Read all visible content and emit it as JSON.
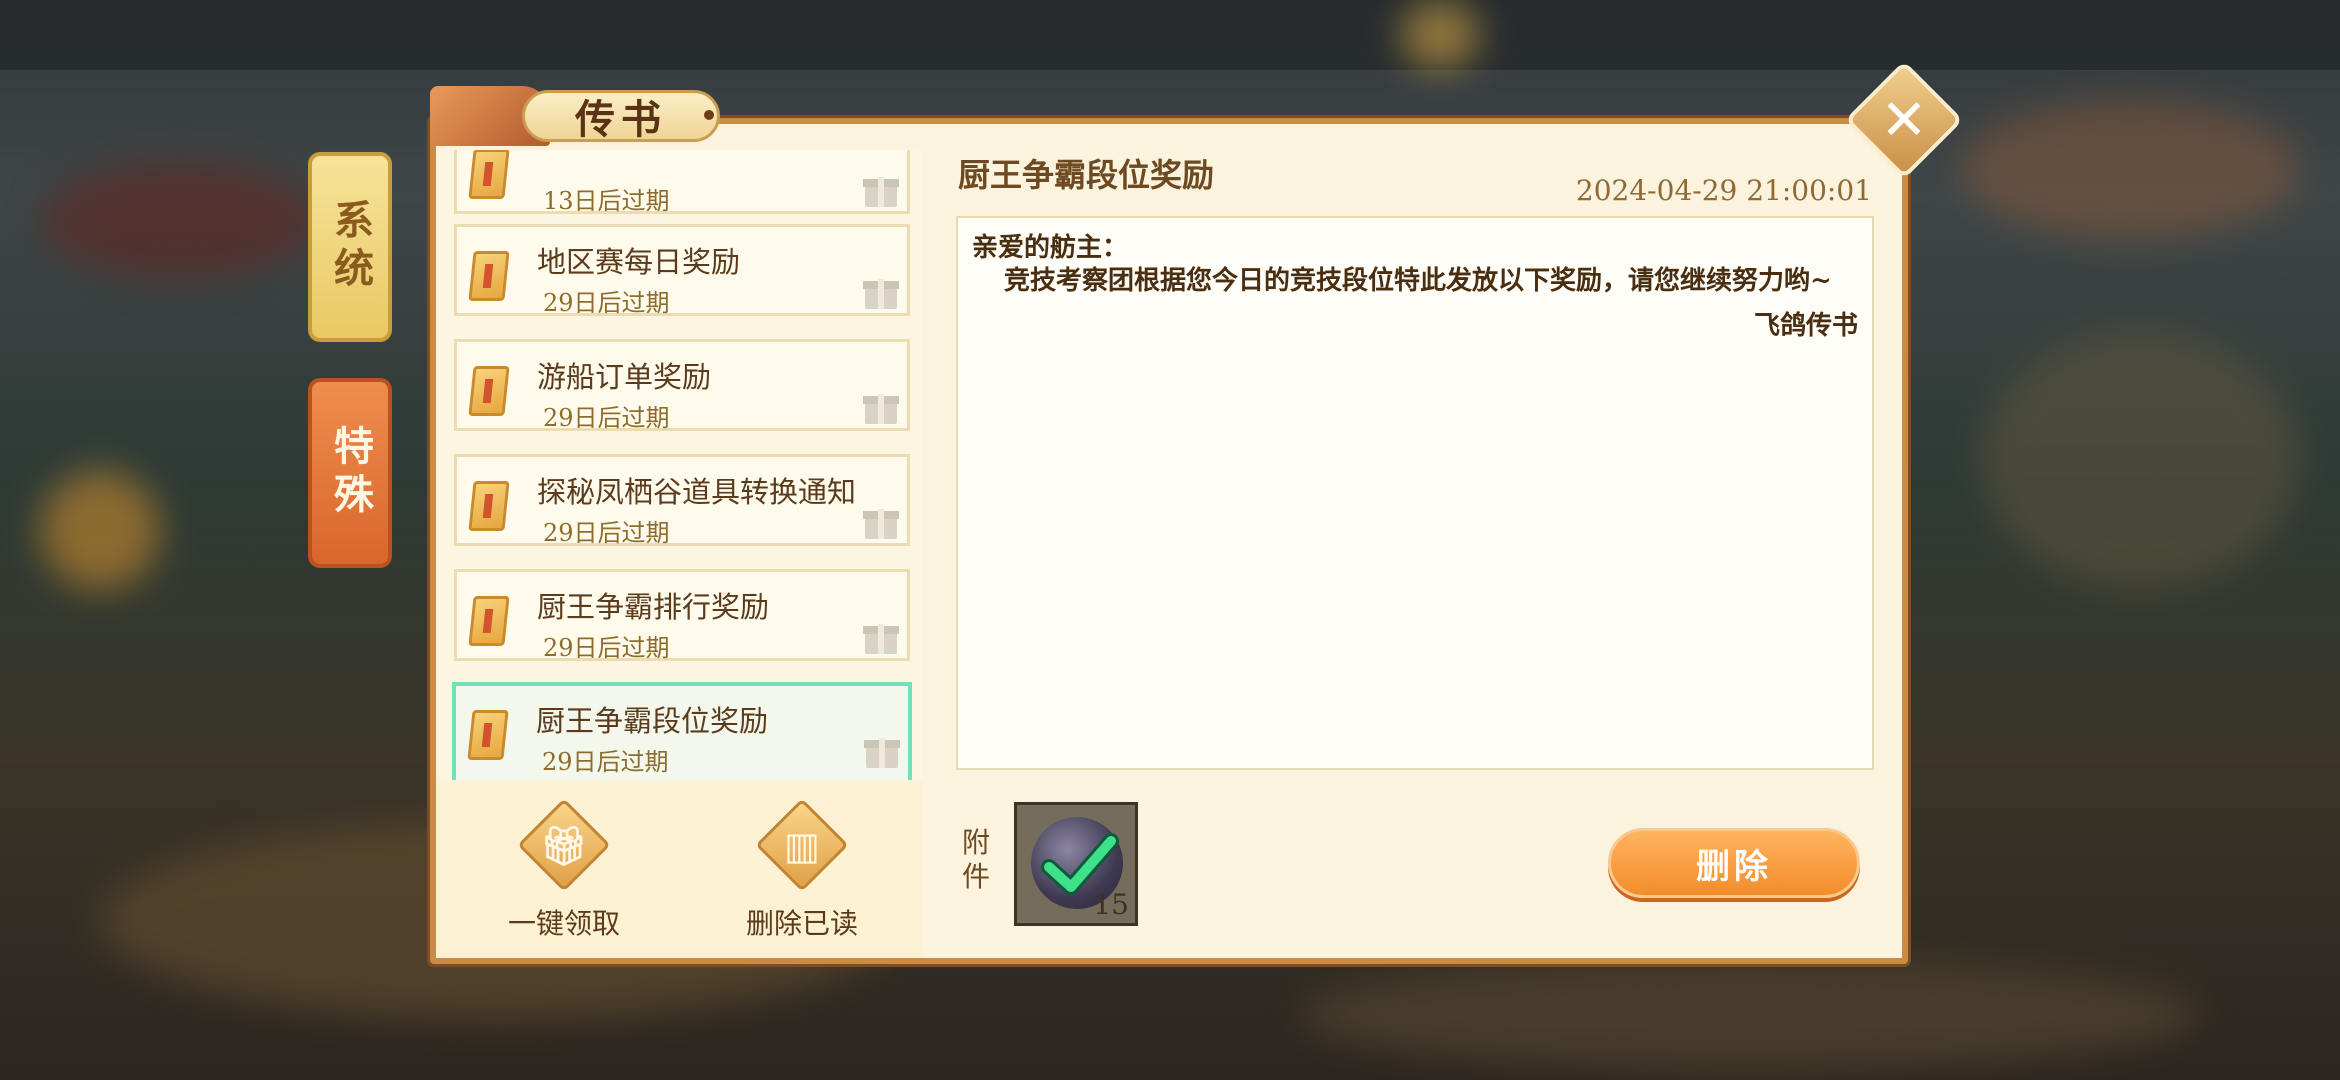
{
  "window": {
    "title": "传书"
  },
  "tabs": [
    {
      "label": "系统",
      "active": false
    },
    {
      "label": "特殊",
      "active": true
    }
  ],
  "mail_list": [
    {
      "title": "",
      "expire": "13日后过期"
    },
    {
      "title": "地区赛每日奖励",
      "expire": "29日后过期"
    },
    {
      "title": "游船订单奖励",
      "expire": "29日后过期"
    },
    {
      "title": "探秘凤栖谷道具转换通知",
      "expire": "29日后过期"
    },
    {
      "title": "厨王争霸排行奖励",
      "expire": "29日后过期"
    },
    {
      "title": "厨王争霸段位奖励",
      "expire": "29日后过期",
      "selected": true
    }
  ],
  "actions": {
    "claim_all": "一键领取",
    "delete_read": "删除已读"
  },
  "detail": {
    "title": "厨王争霸段位奖励",
    "date": "2024-04-29 21:00:01",
    "greeting": "亲爱的舫主：",
    "body": "竞技考察团根据您今日的竞技段位特此发放以下奖励，请您继续努力哟~",
    "signature": "飞鸽传书"
  },
  "attachment": {
    "label": "附件",
    "count": "15"
  },
  "delete_button": "删除",
  "colors": {
    "panel_border": "#c98b45",
    "selected_border": "#72e0bb",
    "delete_button": "#f38d2c"
  }
}
